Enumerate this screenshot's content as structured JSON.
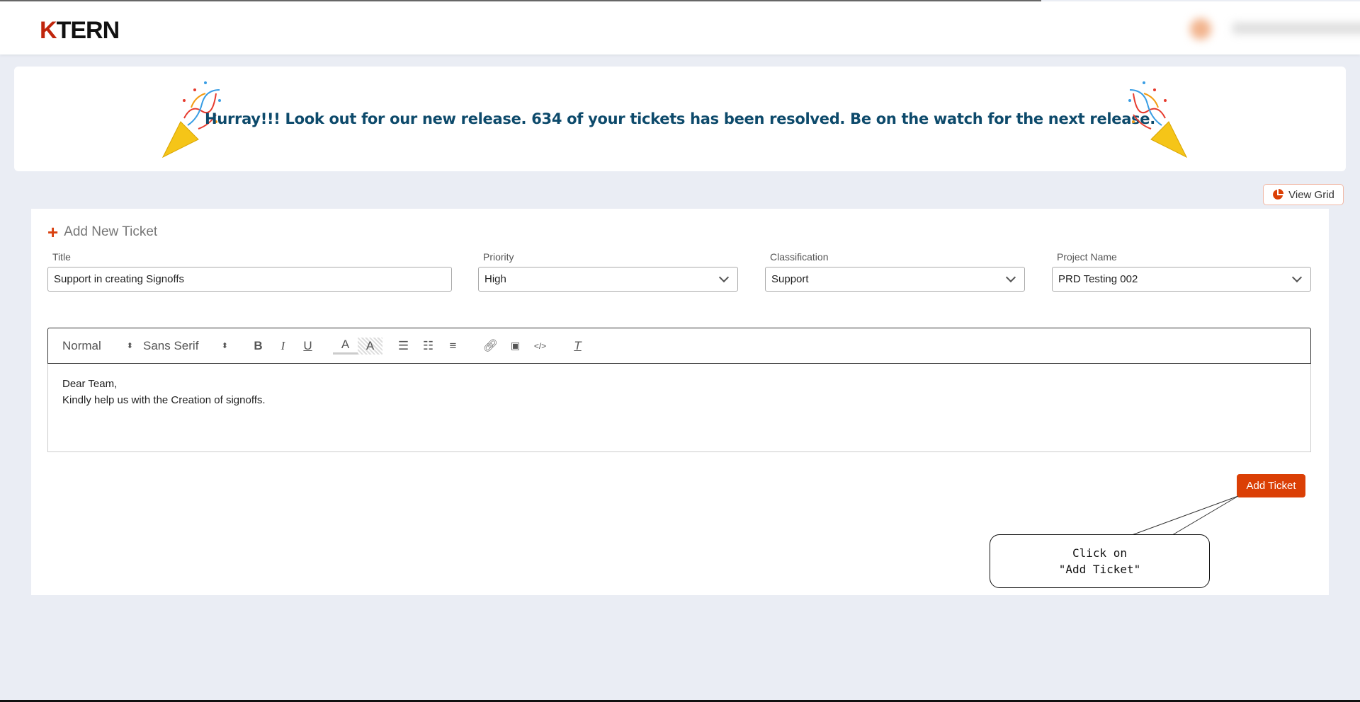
{
  "header": {
    "logo": "KTERN",
    "logo_k": "K",
    "logo_rest": "TERN"
  },
  "banner": {
    "message": "Hurray!!! Look out for our new release. 634 of your tickets has been resolved. Be on the watch for the next release."
  },
  "view_grid": {
    "label": "View Grid",
    "icon": "pie-chart-icon"
  },
  "form": {
    "heading": "Add New Ticket",
    "fields": [
      {
        "label": "Title",
        "value": "Support in creating Signoffs",
        "type": "text"
      },
      {
        "label": "Priority",
        "value": "High",
        "type": "select"
      },
      {
        "label": "Classification",
        "value": "Support",
        "type": "select"
      },
      {
        "label": "Project Name",
        "value": "PRD Testing 002",
        "type": "select"
      }
    ],
    "editor": {
      "format": "Normal",
      "font": "Sans Serif",
      "toolbar_icons": [
        "bold",
        "italic",
        "underline",
        "font-color",
        "background-color",
        "ordered-list",
        "bullet-list",
        "align",
        "link",
        "image",
        "code",
        "clear-format"
      ],
      "lines": [
        "Dear Team,",
        "Kindly help us with the Creation of signoffs."
      ]
    },
    "submit_label": "Add Ticket"
  },
  "callout": {
    "line1": "Click on",
    "line2": "\"Add Ticket\""
  },
  "colors": {
    "accent": "#db3f05",
    "banner_text": "#0d4a6b",
    "background": "#eaedf4"
  }
}
